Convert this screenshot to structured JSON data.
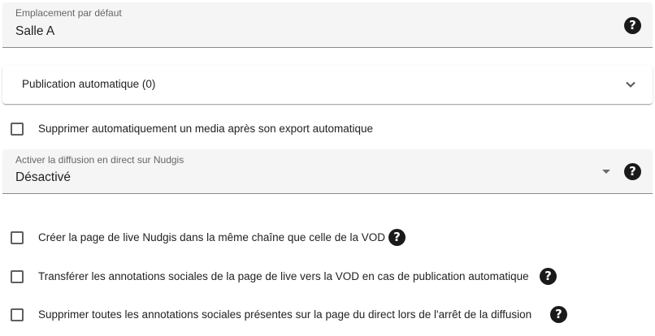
{
  "default_location": {
    "label": "Emplacement par défaut",
    "value": "Salle A",
    "help_icon": "help-circle-icon"
  },
  "auto_publication": {
    "title": "Publication automatique (0)",
    "expanded": false,
    "chevron_icon": "chevron-down-icon"
  },
  "auto_delete": {
    "label": "Supprimer automatiquement un media après son export automatique",
    "checked": false
  },
  "live_streaming": {
    "label": "Activer la diffusion en direct sur Nudgis",
    "value": "Désactivé",
    "caret_icon": "dropdown-caret-icon",
    "help_icon": "help-circle-icon"
  },
  "options": [
    {
      "label": "Créer la page de live Nudgis dans la même chaîne que celle de la VOD",
      "checked": false,
      "has_help": true
    },
    {
      "label": "Transférer les annotations sociales de la page de live vers la VOD en cas de publication automatique",
      "checked": false,
      "has_help": true
    },
    {
      "label": "Supprimer toutes les annotations sociales présentes sur la page du direct lors de l'arrêt de la diffusion",
      "checked": false,
      "has_help": true
    }
  ],
  "help_glyph": "?",
  "colors": {
    "field_bg": "#f5f5f5",
    "help_icon_bg": "#1a1a1a",
    "checkbox_border": "#5f5f5f"
  }
}
